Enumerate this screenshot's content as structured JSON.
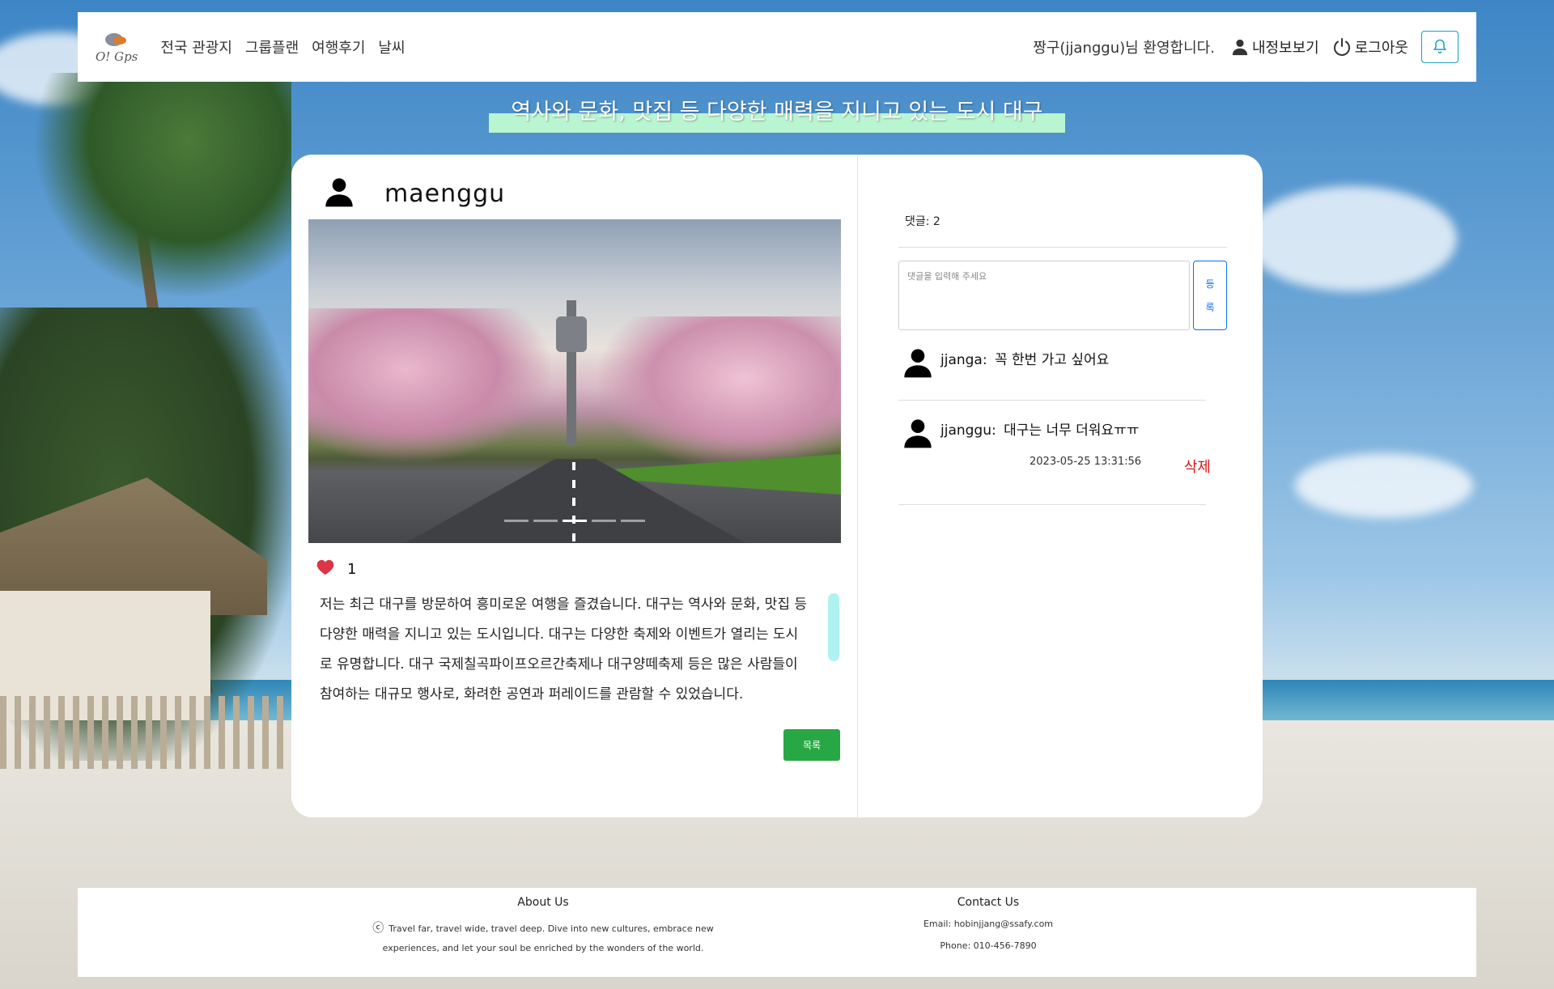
{
  "nav": {
    "logo_text": "O! Gps",
    "links": [
      "전국 관광지",
      "그룹플랜",
      "여행후기",
      "날씨"
    ],
    "welcome": "짱구(jjanggu)님 환영합니다.",
    "my_info": "내정보보기",
    "logout": "로그아웃"
  },
  "headline": "역사와 문화, 맛집 등 다양한 매력을 지니고 있는 도시 대구",
  "post": {
    "author": "maenggu",
    "like_count": "1",
    "content": "저는 최근 대구를 방문하여 흥미로운 여행을 즐겼습니다. 대구는 역사와 문화, 맛집 등 다양한 매력을 지니고 있는 도시입니다. 대구는 다양한 축제와 이벤트가 열리는 도시로 유명합니다. 대구 국제칠곡파이프오르간축제나 대구양떼축제 등은 많은 사람들이 참여하는 대규모 행사로, 화려한 공연과 퍼레이드를 관람할 수 있었습니다.",
    "list_button": "목록",
    "carousel": {
      "count": 5,
      "active": 3
    }
  },
  "comments": {
    "count_label": "댓글: 2",
    "placeholder": "댓글을 입력해 주세요",
    "register_button": [
      "등",
      "록"
    ],
    "items": [
      {
        "user": "jjanga:",
        "text": "꼭 한번 가고 싶어요",
        "date": "",
        "deletable": false
      },
      {
        "user": "jjanggu:",
        "text": "대구는 너무 더워요ㅠㅠ",
        "date": "2023-05-25 13:31:56",
        "deletable": true,
        "delete_label": "삭제"
      }
    ]
  },
  "footer": {
    "about_title": "About Us",
    "about_text": "Travel far, travel wide, travel deep. Dive into new cultures, embrace new experiences, and let your soul be enriched by the wonders of the world.",
    "copyright_symbol": "ⓒ",
    "contact_title": "Contact Us",
    "email": "Email: hobinjjang@ssafy.com",
    "phone": "Phone: 010-456-7890"
  },
  "colors": {
    "like": "#dc3545",
    "list_button": "#28a745",
    "register_button": "#0d6efd",
    "delete": "#dc1414",
    "bell": "#17a2b8",
    "headline_highlight": "#b9f5d0"
  },
  "icons": [
    "person-icon",
    "power-icon",
    "bell-icon",
    "heart-icon",
    "avatar-icon",
    "copyright-icon"
  ]
}
